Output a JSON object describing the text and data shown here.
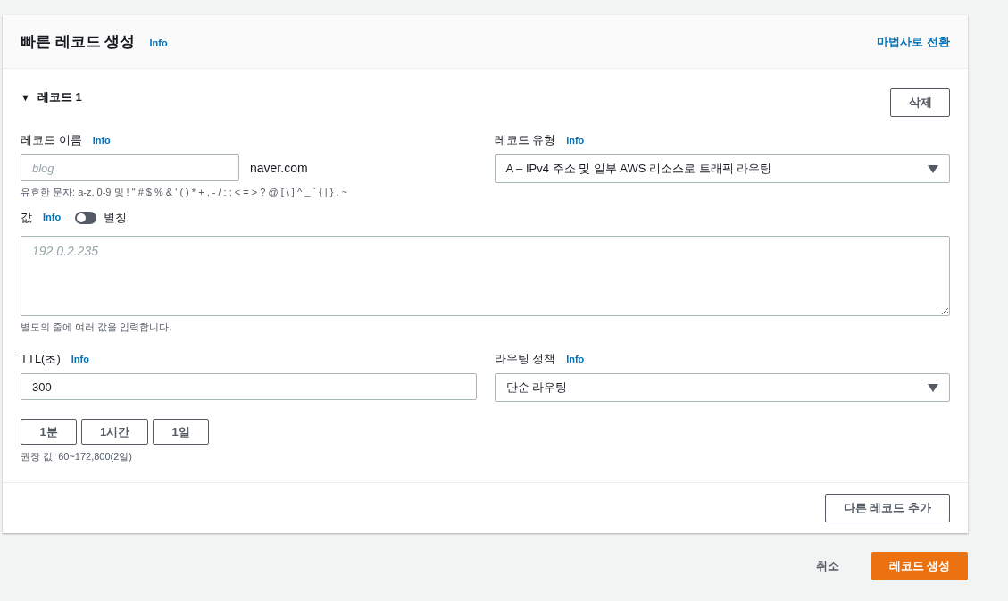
{
  "panel": {
    "title": "빠른 레코드 생성",
    "info": "Info",
    "wizard_link": "마법사로 전환"
  },
  "record": {
    "toggle": "▼",
    "title": "레코드 1",
    "expanded": true,
    "delete_button": "삭제",
    "name_field": {
      "label": "레코드 이름",
      "info": "Info",
      "placeholder": "blog",
      "suffix": "naver.com",
      "hint": "유효한 문자: a-z, 0-9 및 ! \" # $ % & ' ( ) * + , - / : ; < = > ? @ [ \\ ] ^ _ ` { | } . ~"
    },
    "type_field": {
      "label": "레코드 유형",
      "info": "Info",
      "value": "A – IPv4 주소 및 일부 AWS 리소스로 트래픽 라우팅"
    },
    "value_field": {
      "label": "값",
      "info": "Info",
      "alias_label": "별칭",
      "alias_on": false,
      "placeholder": "192.0.2.235",
      "hint": "별도의 줄에 여러 값을 입력합니다."
    },
    "ttl_field": {
      "label": "TTL(초)",
      "info": "Info",
      "value": "300",
      "presets": [
        "1분",
        "1시간",
        "1일"
      ],
      "hint": "권장 값: 60~172,800(2일)"
    },
    "routing_field": {
      "label": "라우팅 정책",
      "info": "Info",
      "value": "단순 라우팅"
    }
  },
  "add_record_button": "다른 레코드 추가",
  "footer": {
    "cancel": "취소",
    "submit": "레코드 생성"
  }
}
